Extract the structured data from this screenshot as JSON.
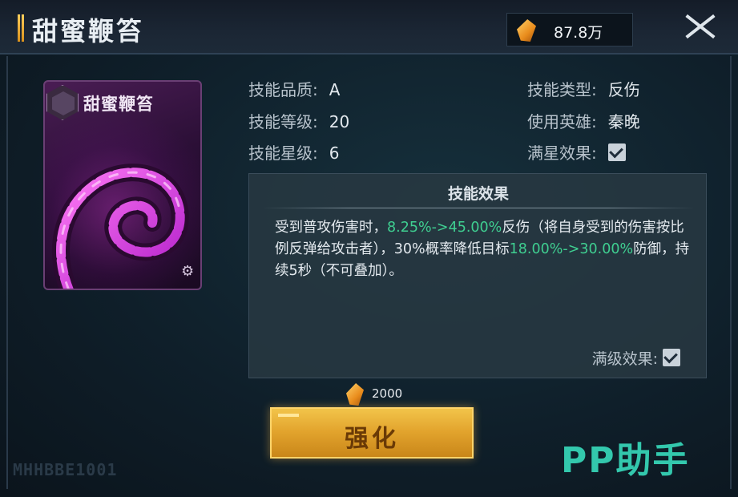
{
  "header": {
    "title": "甜蜜鞭笞",
    "currency_value": "87.8万"
  },
  "card": {
    "title": "甜蜜鞭笞"
  },
  "info": {
    "quality_label": "技能品质:",
    "quality_value": "A",
    "level_label": "技能等级:",
    "level_value": "20",
    "star_label": "技能星级:",
    "star_value": "6",
    "type_label": "技能类型:",
    "type_value": "反伤",
    "hero_label": "使用英雄:",
    "hero_value": "秦晚",
    "max_star_label": "满星效果:",
    "max_star_checked": true
  },
  "effect": {
    "title": "技能效果",
    "text_part1": "受到普攻伤害时，",
    "hl1": "8.25%->45.00%",
    "text_part2": "反伤（将自身受到的伤害按比例反弹给攻击者），30%概率降低目标",
    "hl2": "18.00%->30.00%",
    "text_part3": "防御，持续5秒（不可叠加）。",
    "max_level_label": "满级效果:",
    "max_level_checked": true
  },
  "upgrade": {
    "cost": "2000",
    "label": "强化"
  },
  "watermark": "PP助手",
  "corner_code": "MHHBBE1001",
  "colors": {
    "highlight": "#3fcf91",
    "button": "#e3a52e",
    "watermark": "#33c8ad"
  },
  "icons": {
    "currency": "crystal-icon",
    "close": "close-icon",
    "card_emblem": "hexagon-emblem-icon",
    "card_gear": "gear-icon"
  }
}
